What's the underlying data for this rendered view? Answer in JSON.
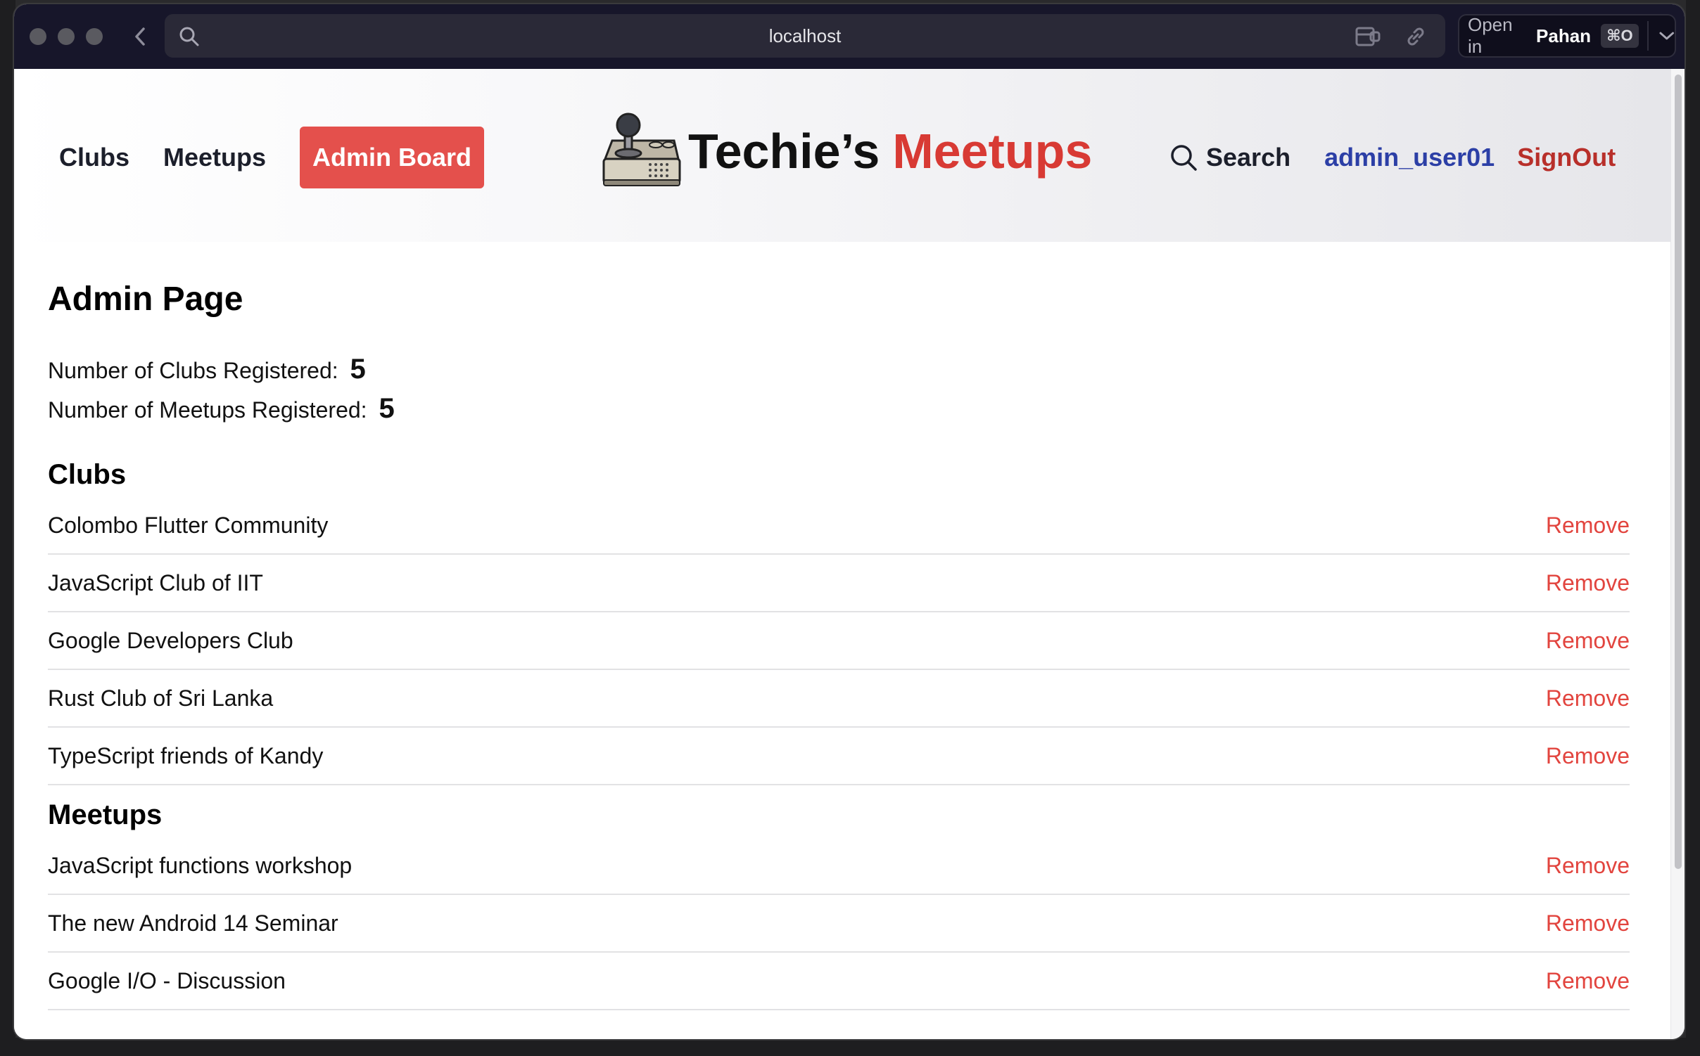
{
  "browser": {
    "url": "localhost",
    "open_in_label": "Open in",
    "open_in_app": "Pahan",
    "open_in_shortcut": "⌘O"
  },
  "nav": {
    "clubs": "Clubs",
    "meetups": "Meetups",
    "admin_board": "Admin Board",
    "search": "Search",
    "user": "admin_user01",
    "signout": "SignOut"
  },
  "logo": {
    "word1": "Techie’s",
    "word2": "Meetups"
  },
  "admin": {
    "title": "Admin Page",
    "clubs_count_label": "Number of Clubs Registered:",
    "clubs_count": "5",
    "meetups_count_label": "Number of Meetups Registered:",
    "meetups_count": "5",
    "clubs_heading": "Clubs",
    "meetups_heading": "Meetups",
    "remove_label": "Remove",
    "clubs": [
      "Colombo Flutter Community",
      "JavaScript Club of IIT",
      "Google Developers Club",
      "Rust Club of Sri Lanka",
      "TypeScript friends of Kandy"
    ],
    "meetups": [
      "JavaScript functions workshop",
      "The new Android 14 Seminar",
      "Google I/O - Discussion"
    ]
  },
  "colors": {
    "accent": "#e4504c",
    "brand_red": "#d83a34",
    "user_blue": "#2c3fa6",
    "titlebar": "#17162a"
  }
}
